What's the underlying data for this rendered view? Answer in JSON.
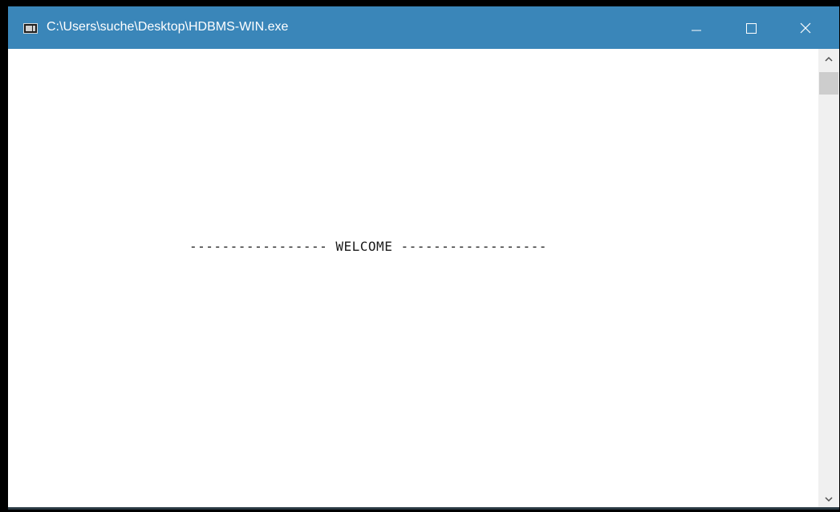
{
  "window": {
    "title": "C:\\Users\\suche\\Desktop\\HDBMS-WIN.exe",
    "titlebar_color": "#3a86b9",
    "controls": {
      "minimize_icon": "minimize-icon",
      "maximize_icon": "maximize-icon",
      "close_icon": "close-icon"
    }
  },
  "console": {
    "welcome_line": "----------------- WELCOME ------------------",
    "background": "#ffffff",
    "text_color": "#1a1a1a"
  },
  "scrollbar": {
    "up_icon": "chevron-up-icon",
    "down_icon": "chevron-down-icon"
  }
}
